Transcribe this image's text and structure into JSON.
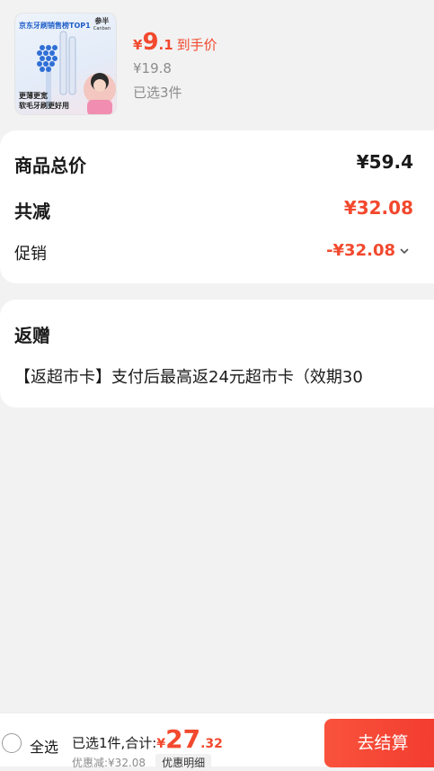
{
  "product": {
    "thumbnail": {
      "badge": "京东牙刷销售榜TOP1",
      "brand": "参半",
      "brand_sub": "Canban",
      "slogan": "更薄更宽\n软毛牙刷更好用"
    },
    "price_currency": "¥",
    "price_integer": "9",
    "price_decimal": ".1",
    "price_tag": "到手价",
    "original_price": "¥19.8",
    "selected_count": "已选3件"
  },
  "summary": {
    "total_label": "商品总价",
    "total_value": "¥59.4",
    "reduce_label": "共减",
    "reduce_value": "¥32.08",
    "promo_label": "促销",
    "promo_value": "-¥32.08"
  },
  "rebate": {
    "title": "返赠",
    "text": "【返超市卡】支付后最高返24元超市卡（效期30"
  },
  "footer": {
    "select_all": "全选",
    "sum_label": "已选1件,合计:",
    "sum_currency": "¥",
    "sum_integer": "27",
    "sum_decimal": ".32",
    "discount_text": "优惠减:¥32.08",
    "discount_detail": "优惠明细",
    "checkout": "去结算"
  },
  "colors": {
    "accent": "#f2492e",
    "checkout_button": "#f23b2f",
    "background": "#f2f2f2"
  }
}
